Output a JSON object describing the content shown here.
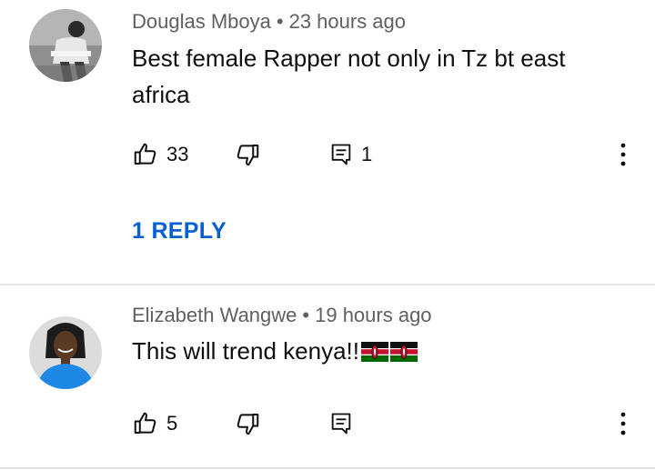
{
  "comments": [
    {
      "author": "Douglas Mboya",
      "separator": "•",
      "time": "23 hours ago",
      "text": "Best female Rapper not only in Tz bt east africa",
      "likes": "33",
      "replies_count": "1",
      "reply_link": "1 REPLY",
      "avatar_icon": "user-photo-avatar"
    },
    {
      "author": "Elizabeth Wangwe",
      "separator": "•",
      "time": "19 hours ago",
      "text": "This will trend kenya!!",
      "emoji": [
        "kenya-flag",
        "kenya-flag"
      ],
      "likes": "5",
      "avatar_icon": "user-photo-avatar"
    }
  ],
  "icons": {
    "like": "thumbs-up-icon",
    "dislike": "thumbs-down-icon",
    "reply": "comment-icon",
    "more": "more-vertical-icon"
  },
  "colors": {
    "link_blue": "#065fd4",
    "meta_gray": "#606060",
    "divider": "#e3e3e3"
  }
}
